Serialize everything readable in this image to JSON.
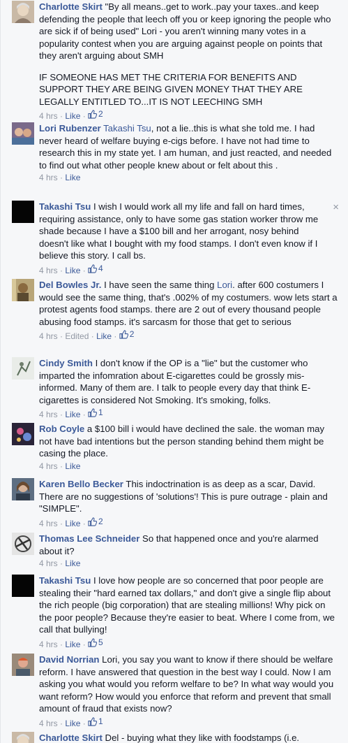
{
  "comments": [
    {
      "author": "Charlotte Skirt",
      "paragraphs": [
        "\"By all means..get to work..pay your taxes..and keep defending the people that leech off you or keep ignoring the people who are sick if of being used\" Lori - you aren't winning many votes in a popularity contest when you are arguing against people on points that they aren't arguing about SMH",
        "IF SOMEONE HAS MET THE CRITERIA FOR BENEFITS AND SUPPORT THEY ARE BEING GIVEN MONEY THAT THEY ARE LEGALLY ENTITLED TO...IT IS NOT LEECHING SMH"
      ],
      "time": "4 hrs",
      "like_label": "Like",
      "like_count": "2"
    },
    {
      "author": "Lori Rubenzer",
      "mention": "Takashi Tsu",
      "text": ", not a lie..this is what she told me. I had never heard of welfare buying e-cigs before. I have not had time to research this in my state yet. I am human, and just reacted, and needed to find out what other people knew about or felt about this .",
      "time": "4 hrs",
      "like_label": "Like"
    },
    {
      "author": "Takashi Tsu",
      "text": "I wish I would work all my life and fall on hard times, requiring assistance, only to have some gas station worker throw me shade because I have a $100 bill and her arrogant, nosy behind doesn't like what I bought with my food stamps. I don't even know if I believe this story. I call bs.",
      "time": "4 hrs",
      "like_label": "Like",
      "like_count": "4",
      "close": "×"
    },
    {
      "author": "Del Bowles Jr.",
      "text_before": "I have seen the same thing ",
      "mention": "Lori",
      "text": ". after 600 costumers I would see the same thing, that's .002% of my costumers. wow lets start a protest agents food stamps. there are 2 out of every thousand people abusing food stamps. it's sarcasm for those that get to serious",
      "time": "4 hrs",
      "edited": "Edited",
      "like_label": "Like",
      "like_count": "2"
    },
    {
      "author": "Cindy Smith",
      "text": "I don't know if the OP is a \"lie\" but the customer who imparted the infomration about E-cigarettes could be grossly mis-informed. Many of them are. I talk to people every day that think E-cigarettes is considered Not Smoking. It's smoking, folks.",
      "time": "4 hrs",
      "like_label": "Like",
      "like_count": "1"
    },
    {
      "author": "Rob Coyle",
      "text": "a $100 bill i would have declined the sale. the woman may not have bad intentions but the person standing behind them might be casing the place.",
      "time": "4 hrs",
      "like_label": "Like"
    },
    {
      "author": "Karen Bello Becker",
      "text": "This indoctrination is as deep as a scar, David. There are no suggestions of 'solutions'! This is pure outrage - plain and \"SIMPLE\".",
      "time": "4 hrs",
      "like_label": "Like",
      "like_count": "2"
    },
    {
      "author": "Thomas Lee Schneider",
      "text": "So that happened once and you're alarmed about it?",
      "time": "4 hrs",
      "like_label": "Like"
    },
    {
      "author": "Takashi Tsu",
      "text": "I love how people are so concerned that poor people are stealing their \"hard earned tax dollars,\" and don't give a single flip about the rich people (big corporation) that are stealing millions! Why pick on the poor people? Because they're easier to beat. Where I come from, we call that bullying!",
      "time": "4 hrs",
      "like_label": "Like",
      "like_count": "5"
    },
    {
      "author": "David Norrian",
      "text": "Lori, you say you want to know if there should be welfare reform. I have answered that question in the best way I could. Now I am asking you what would you reform welfare to be? In what way would you want reform? How would you enforce that reform and prevent that small amount of fraud that exists now?",
      "time": "4 hrs",
      "like_label": "Like",
      "like_count": "1"
    },
    {
      "author": "Charlotte Skirt",
      "text": "Del - buying what they like with foodstamps (i.e."
    }
  ],
  "colors": {
    "link": "#3b5998",
    "meta": "#9197a3",
    "text": "#141823",
    "background": "#f6f7f9"
  }
}
